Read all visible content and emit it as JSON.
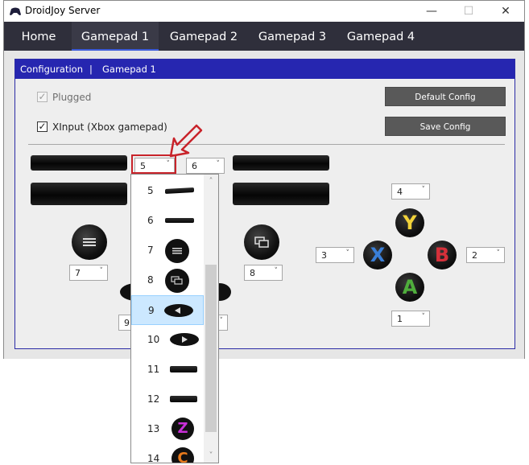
{
  "window": {
    "title": "DroidJoy Server",
    "controls": {
      "minimize": "—",
      "maximize": "☐",
      "close": "✕"
    }
  },
  "nav": {
    "tabs": [
      {
        "label": "Home"
      },
      {
        "label": "Gamepad 1",
        "active": true
      },
      {
        "label": "Gamepad 2"
      },
      {
        "label": "Gamepad 3"
      },
      {
        "label": "Gamepad 4"
      }
    ]
  },
  "panel": {
    "breadcrumb": {
      "section": "Configuration",
      "separator": "|",
      "page": "Gamepad 1"
    },
    "plugged": {
      "label": "Plugged",
      "checked": true,
      "enabled": false
    },
    "xinput": {
      "label": "XInput (Xbox gamepad)",
      "checked": true,
      "enabled": true
    },
    "default_config_label": "Default Config",
    "save_config_label": "Save Config"
  },
  "mapping": {
    "left_trigger_value": "5",
    "right_trigger_value": "6",
    "back_value": "7",
    "start_value": "8",
    "dpad_left_value": "9",
    "y_value": "4",
    "x_value": "3",
    "b_value": "2",
    "a_value": "1",
    "face_letters": {
      "y": "Y",
      "x": "X",
      "b": "B",
      "a": "A"
    }
  },
  "dropdown": {
    "options": [
      "5",
      "6",
      "7",
      "8",
      "9",
      "10",
      "11",
      "12",
      "13",
      "14"
    ],
    "selected": "9",
    "scroll_up": "˄",
    "scroll_down": "˅"
  },
  "colors": {
    "nav_bg": "#2f2f3b",
    "panel_header": "#2626b0",
    "accent_red": "#c8232a",
    "y_color": "#f2d33a",
    "x_color": "#3a7fd8",
    "b_color": "#d6303a",
    "a_color": "#4fae3c"
  }
}
